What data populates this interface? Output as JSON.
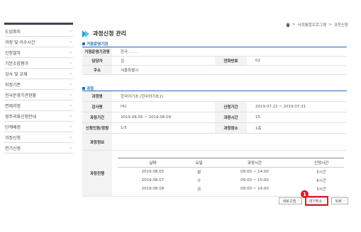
{
  "sidebar": {
    "items": [
      {
        "label": "도입취지"
      },
      {
        "label": "과정 및 이수시간"
      },
      {
        "label": "신청절차"
      },
      {
        "label": "기본소양평가"
      },
      {
        "label": "강사 및 교재"
      },
      {
        "label": "지정기준"
      },
      {
        "label": "전국운영기관현황"
      },
      {
        "label": "면제과정"
      },
      {
        "label": "영주귀화신청안내"
      },
      {
        "label": "단계배정"
      },
      {
        "label": "과정신청"
      },
      {
        "label": "연기신청"
      }
    ]
  },
  "breadcrumb": {
    "items": [
      "사회통합프로그램",
      "과정신청"
    ],
    "separator": ">"
  },
  "page": {
    "title": "과정신청 관리"
  },
  "agency": {
    "section_title": "거점운영기관",
    "name_label": "거점운영기관명",
    "name_value": "한국 ...  ...",
    "manager_label": "담당자",
    "manager_value": "김",
    "phone_label": "전화번호",
    "phone_value": "02",
    "address_label": "주소",
    "address_value": "서울특별시"
  },
  "course": {
    "section_title": "과정",
    "course_name_label": "과정명",
    "course_name_value": "한국어기초 (한국어기초1)",
    "instructor_label": "강사명",
    "instructor_value": "HU",
    "apply_period_label": "신청기간",
    "apply_period_value": "2019.07.22 ~ 2019.07.31",
    "course_period_label": "과정기간",
    "course_period_value": "2019.08.05 ~ 2019.08.09",
    "course_hours_label": "과정시간",
    "course_hours_value": "15",
    "enrollment_label": "신청인원/정원",
    "enrollment_value": "1/5",
    "room_label": "과정장소",
    "room_value": "1층",
    "info_label": "과정정보",
    "schedule_label": "과정진행",
    "schedule_headers": [
      "날짜",
      "요일",
      "과정시간",
      "인정시간"
    ],
    "schedule_rows": [
      {
        "date": "2019.08.05",
        "day": "월",
        "time": "09:00 ~ 14:00",
        "hours": "5시간"
      },
      {
        "date": "2019.08.07",
        "day": "수",
        "time": "09:00 ~ 15:00",
        "hours": "6시간"
      },
      {
        "date": "2019.08.09",
        "day": "금",
        "time": "09:00 ~ 14:00",
        "hours": "5시간"
      }
    ]
  },
  "buttons": {
    "refresh_label": "새로고침",
    "cancel_wait_label": "대기취소",
    "back_label": "뒤로"
  },
  "annotation": {
    "badge_number": "1",
    "highlight_color": "#d9202a"
  },
  "colors": {
    "accent": "#1b6bb8",
    "title_icon": "#1aa5d8",
    "sidebar_bar": "#3d4250"
  }
}
